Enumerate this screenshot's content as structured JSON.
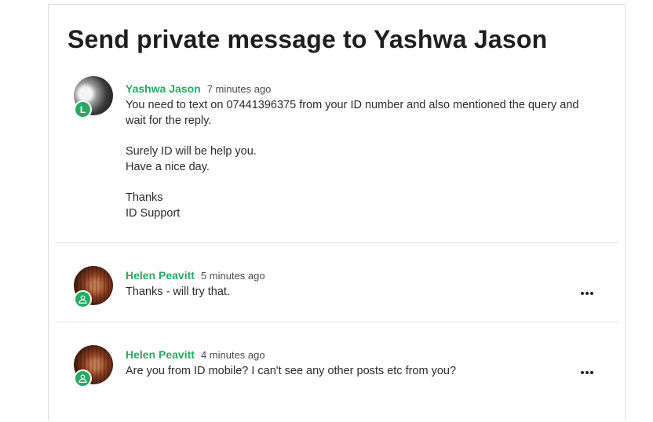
{
  "page": {
    "title": "Send private message to Yashwa Jason"
  },
  "colors": {
    "author": "#2aa863",
    "badge": "#2aa863",
    "divider": "#e2e2e2"
  },
  "messages": [
    {
      "author": "Yashwa Jason",
      "time": "7 minutes ago",
      "badge_letter": "L",
      "lines": [
        "You need to text on 07441396375 from your ID number and also mentioned the query and wait for the reply.",
        "",
        "Surely ID will be help you.",
        "Have a nice day.",
        "",
        "Thanks",
        "ID Support"
      ]
    },
    {
      "author": "Helen Peavitt",
      "time": "5 minutes ago",
      "badge_icon": "user-icon",
      "lines": [
        "Thanks - will try that."
      ],
      "more_icon": "more-options-icon"
    },
    {
      "author": "Helen Peavitt",
      "time": "4 minutes ago",
      "badge_icon": "user-icon",
      "lines": [
        "Are you from ID mobile? I can't see any other posts etc from you?"
      ],
      "more_icon": "more-options-icon"
    }
  ]
}
